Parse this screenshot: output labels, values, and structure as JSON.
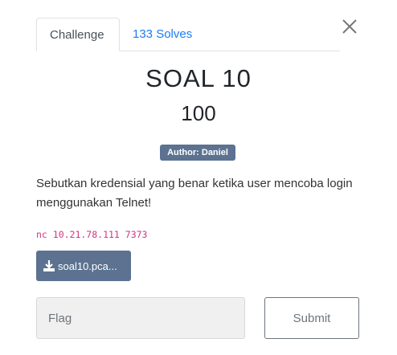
{
  "tabs": {
    "challenge": "Challenge",
    "solves": "133 Solves"
  },
  "challenge": {
    "name": "SOAL 10",
    "value": "100",
    "author": "Author: Daniel",
    "description": "Sebutkan kredensial yang benar ketika user mencoba login menggunakan Telnet!",
    "connection": "nc 10.21.78.111 7373",
    "file": "soal10.pca..."
  },
  "form": {
    "flag_placeholder": "Flag",
    "submit_label": "Submit"
  }
}
